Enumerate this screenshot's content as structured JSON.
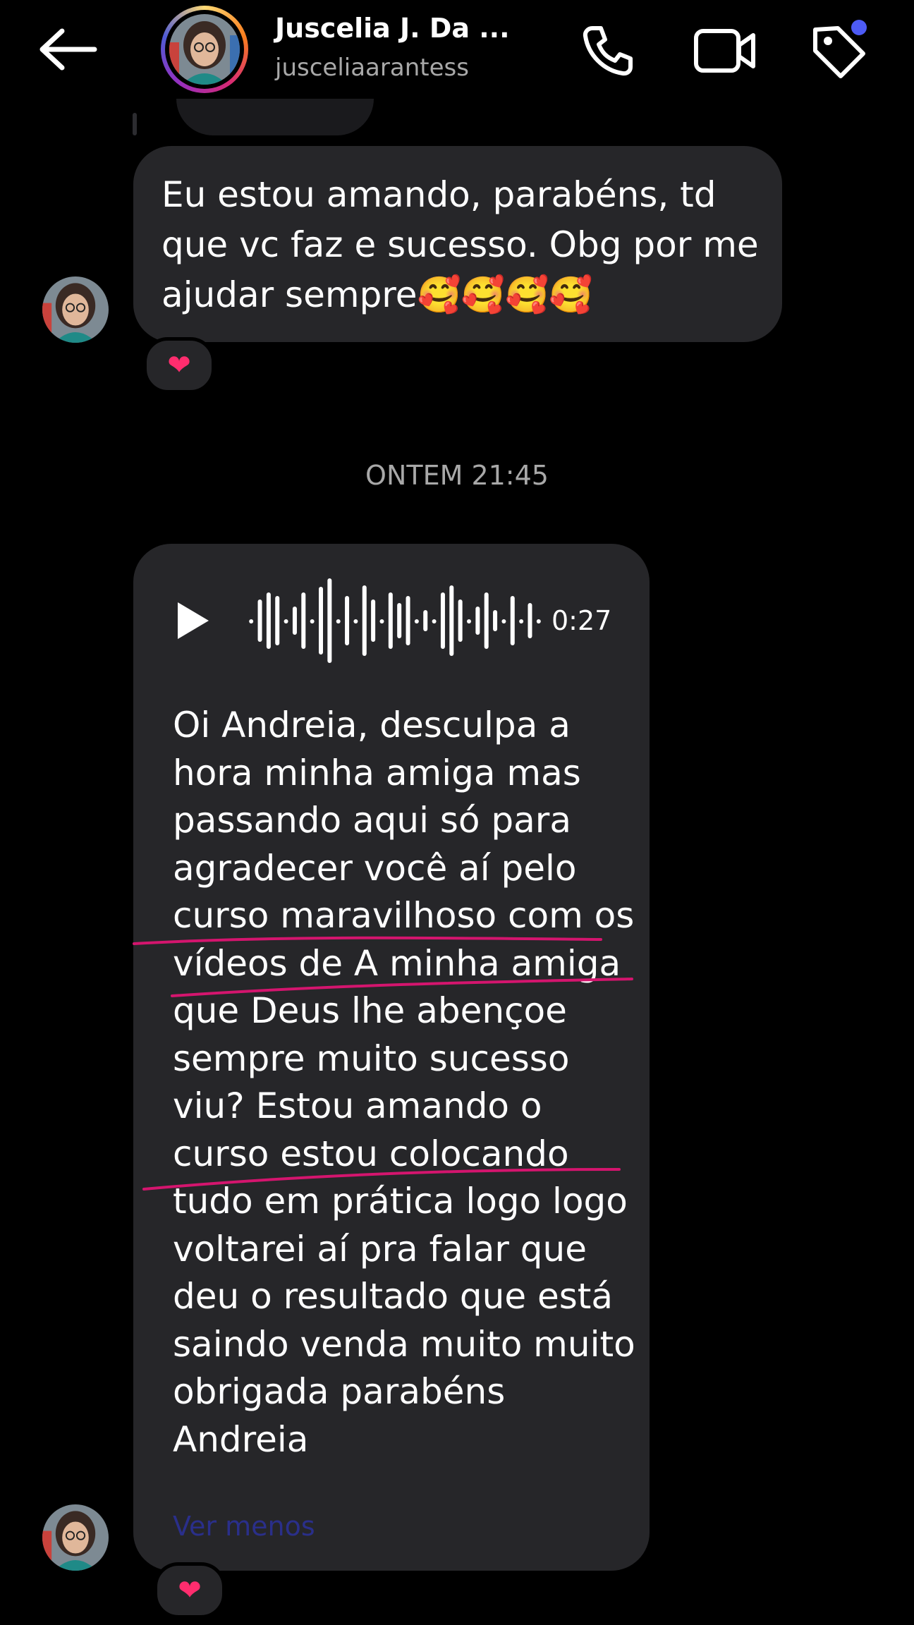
{
  "header": {
    "contact_name": "Juscelia J. Da ...",
    "username": "jusceliaarantess",
    "icons": [
      "back-arrow-icon",
      "phone-icon",
      "video-camera-icon",
      "tag-icon"
    ]
  },
  "messages": [
    {
      "text": "Eu estou amando, parabéns, td que vc faz e sucesso. Obg por me ajudar sempre🥰🥰🥰🥰",
      "reaction": "❤"
    }
  ],
  "timestamp": "ONTEM 21:45",
  "voice_message": {
    "duration": "0:27",
    "transcript": "Oi Andreia, desculpa a hora minha amiga mas passando aqui só para agradecer você aí pelo curso maravilhoso com os vídeos de A minha amiga que Deus lhe abençoe sempre muito sucesso viu? Estou amando o curso estou colocando tudo em prática logo logo voltarei aí pra falar que deu o resultado que está saindo venda muito muito obrigada parabéns Andreia",
    "see_less_label": "Ver menos",
    "reaction": "❤"
  },
  "colors": {
    "background": "#000000",
    "bubble": "#262629",
    "secondary_text": "#a8a8a8",
    "badge": "#4d5bf5",
    "annotation_underline": "#d4156e",
    "heart": "#ff2d6e"
  }
}
